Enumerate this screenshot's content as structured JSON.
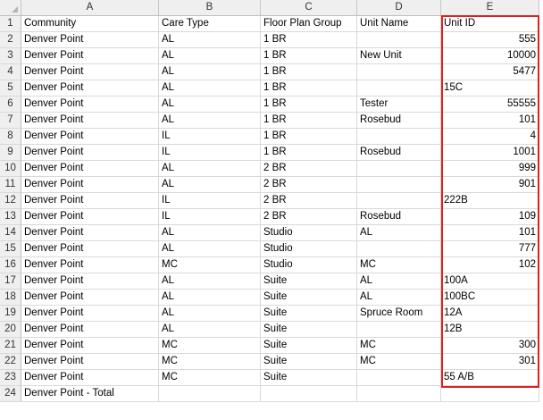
{
  "columns": [
    "A",
    "B",
    "C",
    "D",
    "E"
  ],
  "header_row": [
    "Community",
    "Care Type",
    "Floor Plan Group",
    "Unit Name",
    "Unit ID"
  ],
  "rows": [
    [
      "Denver Point",
      "AL",
      "1 BR",
      "",
      "555"
    ],
    [
      "Denver Point",
      "AL",
      "1 BR",
      "New Unit",
      "10000"
    ],
    [
      "Denver Point",
      "AL",
      "1 BR",
      "",
      "5477"
    ],
    [
      "Denver Point",
      "AL",
      "1 BR",
      "",
      "15C"
    ],
    [
      "Denver Point",
      "AL",
      "1 BR",
      "Tester",
      "55555"
    ],
    [
      "Denver Point",
      "AL",
      "1 BR",
      "Rosebud",
      "101"
    ],
    [
      "Denver Point",
      "IL",
      "1 BR",
      "",
      "4"
    ],
    [
      "Denver Point",
      "IL",
      "1 BR",
      "Rosebud",
      "1001"
    ],
    [
      "Denver Point",
      "AL",
      "2 BR",
      "",
      "999"
    ],
    [
      "Denver Point",
      "AL",
      "2 BR",
      "",
      "901"
    ],
    [
      "Denver Point",
      "IL",
      "2 BR",
      "",
      "222B"
    ],
    [
      "Denver Point",
      "IL",
      "2 BR",
      "Rosebud",
      "109"
    ],
    [
      "Denver Point",
      "AL",
      "Studio",
      "AL",
      "101"
    ],
    [
      "Denver Point",
      "AL",
      "Studio",
      "",
      "777"
    ],
    [
      "Denver Point",
      "MC",
      "Studio",
      "MC",
      "102"
    ],
    [
      "Denver Point",
      "AL",
      "Suite",
      "AL",
      "100A"
    ],
    [
      "Denver Point",
      "AL",
      "Suite",
      "AL",
      "100BC"
    ],
    [
      "Denver Point",
      "AL",
      "Suite",
      "Spruce Room",
      "12A"
    ],
    [
      "Denver Point",
      "AL",
      "Suite",
      "",
      "12B"
    ],
    [
      "Denver Point",
      "MC",
      "Suite",
      "MC",
      "300"
    ],
    [
      "Denver Point",
      "MC",
      "Suite",
      "MC",
      "301"
    ],
    [
      "Denver Point",
      "MC",
      "Suite",
      "",
      "55 A/B"
    ],
    [
      "Denver Point - Total",
      "",
      "",
      "",
      ""
    ]
  ],
  "colors": {
    "highlight_border": "#e02020",
    "header_bg": "#efefef",
    "gridline": "#d9d9d9"
  }
}
